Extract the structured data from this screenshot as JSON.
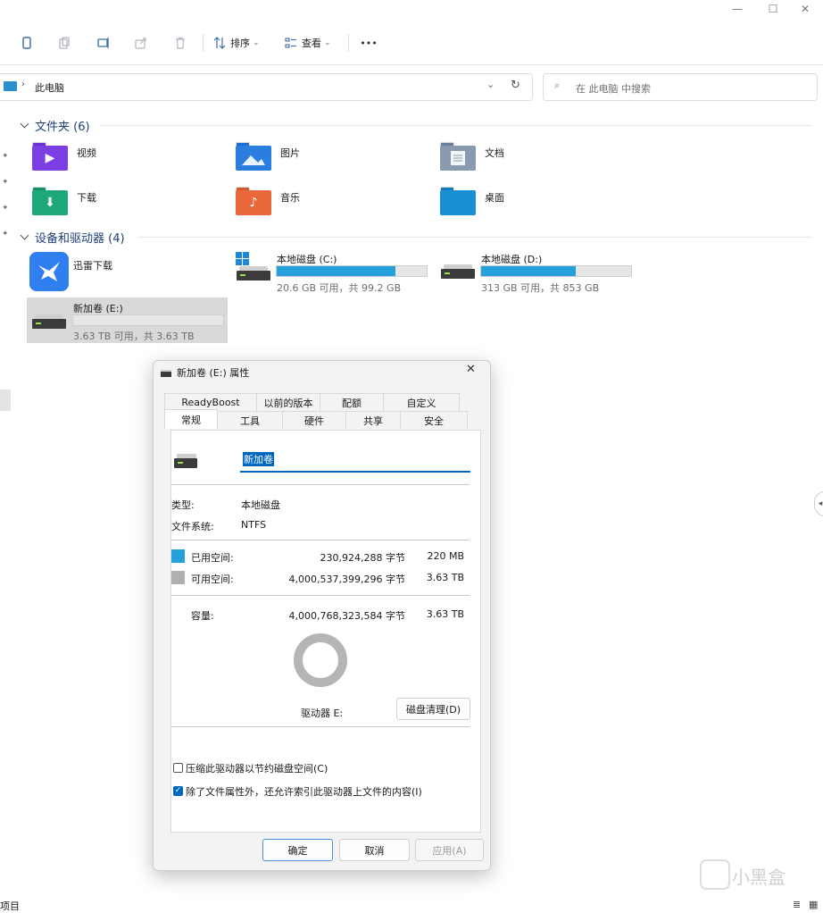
{
  "window": {
    "controls": {
      "minimize": "—",
      "maximize": "☐",
      "close": "✕"
    }
  },
  "toolbar": {
    "sort_label": "排序",
    "view_label": "查看",
    "more_label": "•••"
  },
  "address": {
    "breadcrumb_label": "此电脑",
    "search_placeholder": "在 此电脑 中搜索"
  },
  "folders": {
    "title": "文件夹 (6)",
    "items": [
      {
        "label": "视频",
        "icon": "video-folder-icon",
        "color": "#7b3fe4"
      },
      {
        "label": "图片",
        "icon": "pictures-folder-icon",
        "color": "#2b7de0"
      },
      {
        "label": "文档",
        "icon": "documents-folder-icon",
        "color": "#7a8ea8"
      },
      {
        "label": "下载",
        "icon": "downloads-folder-icon",
        "color": "#1ea87a"
      },
      {
        "label": "音乐",
        "icon": "music-folder-icon",
        "color": "#e8683b"
      },
      {
        "label": "桌面",
        "icon": "desktop-folder-icon",
        "color": "#1a8fd6"
      }
    ]
  },
  "devices": {
    "title": "设备和驱动器 (4)",
    "items": [
      {
        "name": "迅雷下载"
      },
      {
        "name": "本地磁盘 (C:)",
        "sub": "20.6 GB 可用，共 99.2 GB",
        "used_fraction": 0.79
      },
      {
        "name": "本地磁盘 (D:)",
        "sub": "313 GB 可用，共 853 GB",
        "used_fraction": 0.63
      },
      {
        "name": "新加卷 (E:)",
        "sub": "3.63 TB 可用，共 3.63 TB",
        "used_fraction": 0.0
      }
    ]
  },
  "status": {
    "items_label": "项目"
  },
  "watermark": "小黑盒",
  "dialog": {
    "title": "新加卷 (E:) 属性",
    "tabs_top": [
      "ReadyBoost",
      "以前的版本",
      "配额",
      "自定义"
    ],
    "tabs_bottom": [
      "常规",
      "工具",
      "硬件",
      "共享",
      "安全"
    ],
    "active_tab": "常规",
    "volume_name": "新加卷",
    "type_label": "类型:",
    "type_value": "本地磁盘",
    "fs_label": "文件系统:",
    "fs_value": "NTFS",
    "used_label": "已用空间:",
    "used_bytes": "230,924,288 字节",
    "used_size": "220 MB",
    "used_color": "#26a0da",
    "free_label": "可用空间:",
    "free_bytes": "4,000,537,399,296 字节",
    "free_size": "3.63 TB",
    "free_color": "#b0b0b0",
    "capacity_label": "容量:",
    "capacity_bytes": "4,000,768,323,584 字节",
    "capacity_size": "3.63 TB",
    "drive_label": "驱动器 E:",
    "cleanup_button": "磁盘清理(D)",
    "compress_label": "压缩此驱动器以节约磁盘空间(C)",
    "compress_checked": false,
    "index_label": "除了文件属性外，还允许索引此驱动器上文件的内容(I)",
    "index_checked": true,
    "ok_button": "确定",
    "cancel_button": "取消",
    "apply_button": "应用(A)"
  }
}
